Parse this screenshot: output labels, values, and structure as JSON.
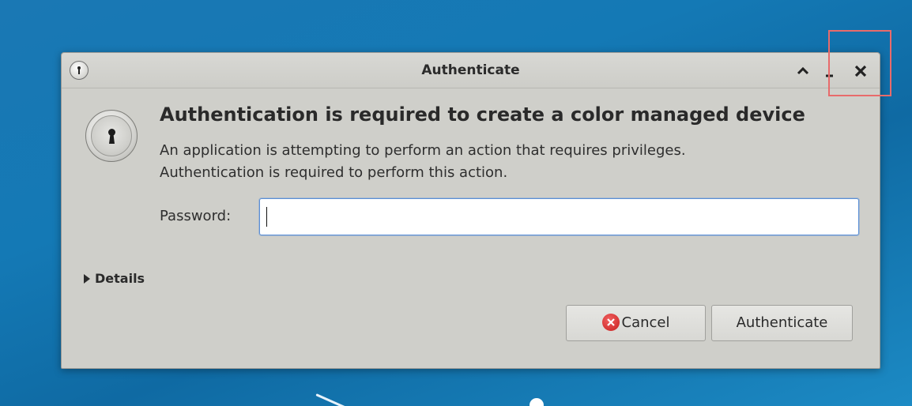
{
  "window": {
    "title": "Authenticate"
  },
  "dialog": {
    "heading": "Authentication is required to create a color managed device",
    "description_line1": "An application is attempting to perform an action that requires privileges.",
    "description_line2": "Authentication is required to perform this action.",
    "password_label": "Password:",
    "password_value": "",
    "details_label": "Details",
    "cancel_label": "Cancel",
    "authenticate_label": "Authenticate"
  },
  "icons": {
    "title_icon": "lock-icon",
    "main_icon": "lock-icon",
    "maximize": "chevron-up-icon",
    "minimize": "minimize-icon",
    "close": "close-icon",
    "cancel": "cancel-icon",
    "details": "triangle-right-icon"
  },
  "colors": {
    "desktop_background": "#1479b5",
    "dialog_background": "#cfcfca",
    "input_focus_border": "#5b8fd6",
    "cancel_icon": "#d42a2a",
    "highlight": "#e86b6b"
  }
}
